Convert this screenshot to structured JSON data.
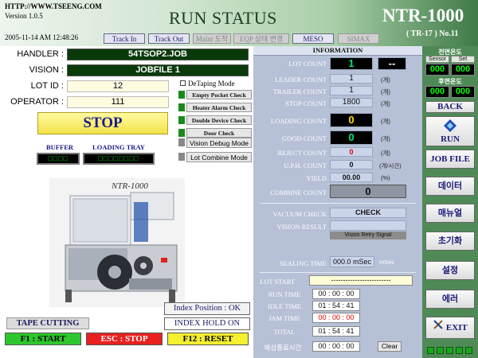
{
  "header": {
    "url": "HTTP://WWW.TSEENG.COM",
    "version": "Version 1.0.5",
    "datetime": "2005-11-14 AM 12:48:26",
    "title": "RUN STATUS",
    "product": "NTR-1000",
    "product_sub": "( TR-17 ) No.11",
    "tabs": [
      {
        "label": "Track In"
      },
      {
        "label": "Track Out"
      },
      {
        "label": "Maint 도착"
      },
      {
        "label": "EQP 상태 변경"
      },
      {
        "label": "MESO"
      },
      {
        "label": "SIMAX"
      }
    ]
  },
  "left": {
    "handler_label": "HANDLER :",
    "handler_value": "54TSOP2.JOB",
    "vision_label": "VISION :",
    "vision_value": "JOBFILE 1",
    "lotid_label": "LOT ID :",
    "lotid_value": "12",
    "operator_label": "OPERATOR :",
    "operator_value": "111",
    "detaping_label": "DeTaping Mode",
    "status": "STOP",
    "buffer_label": "BUFFER",
    "loading_tray_label": "LOADING TRAY",
    "buffer_value": "□□□□",
    "loading_tray_value": "□□□□□□□□",
    "checks": [
      "Empty Pocket Check",
      "Heater Alarm Check",
      "Double Device Check",
      "Door Check"
    ],
    "modes": [
      "Vision Debug Mode",
      "Lot Combine Mode"
    ],
    "machine_label": "NTR-1000",
    "index_position": "Index Position : OK",
    "index_hold": "INDEX HOLD ON",
    "tape_cutting": "TAPE CUTTING",
    "fkeys": [
      {
        "label": "F1 :  START",
        "color": "#2dc72d"
      },
      {
        "label": "ESC :  STOP",
        "color": "#e82020"
      },
      {
        "label": "F12 : RESET",
        "color": "#f5f030"
      }
    ]
  },
  "info": {
    "title": "INFORMATION",
    "lot_count_label": "LOT COUNT",
    "lot_count": "1",
    "lot_count_extra": "--",
    "leader_label": "LEADER COUNT",
    "leader_value": "1",
    "trailer_label": "TRAILER COUNT",
    "trailer_value": "1",
    "stop_label": "STOP COUNT",
    "stop_value": "1800",
    "unit_ea": "(개)",
    "loading_label": "LOADING COUNT",
    "loading_value": "0",
    "good_label": "GOOD COUNT",
    "good_value": "0",
    "reject_label": "REJECT COUNT",
    "reject_value": "0",
    "uph_label": "U.P.H. COUNT",
    "uph_value": "0",
    "uph_unit": "(개/시간)",
    "yield_label": "YIELD",
    "yield_value": "00.00",
    "yield_unit": "(%)",
    "combine_label": "COMBINE COUNT",
    "combine_value": "0",
    "vacuum_label": "VACUUM CHECK",
    "vacuum_value": "CHECK",
    "vision_result_label": "VISION RESULT",
    "vision_result_value": "",
    "vision_retry": "Vision Retry Signal",
    "sealing_label": "SEALING TIME",
    "sealing_value": "000.0 mSec",
    "sealing_unit": "mSec",
    "lot_start_label": "LOT START",
    "lot_start_value": "-------------------------",
    "run_label": "RUN TIME",
    "run_value": "00 : 00 : 00",
    "idle_label": "IDLE TIME",
    "idle_value": "01 : 54 : 41",
    "jam_label": "JAM TIME",
    "jam_value": "00 : 00 : 00",
    "total_label": "TOTAL",
    "total_value": "01 : 54 : 41",
    "est_label": "예상종료시간",
    "est_value": "00 : 00 : 00",
    "clear_label": "Clear"
  },
  "right": {
    "front_temp": "전면온도",
    "sensor_label": "Sensor",
    "set_label": "Set",
    "front_sensor": "000",
    "front_set": "000",
    "rear_temp": "후면온도",
    "rear_sensor": "000",
    "rear_set": "000",
    "back": "BACK",
    "run": "RUN",
    "jobfile": "JOB FILE",
    "data": "데이터",
    "manual": "매뉴얼",
    "init": "초기화",
    "setup": "설정",
    "error": "에러",
    "exit": "EXIT"
  }
}
